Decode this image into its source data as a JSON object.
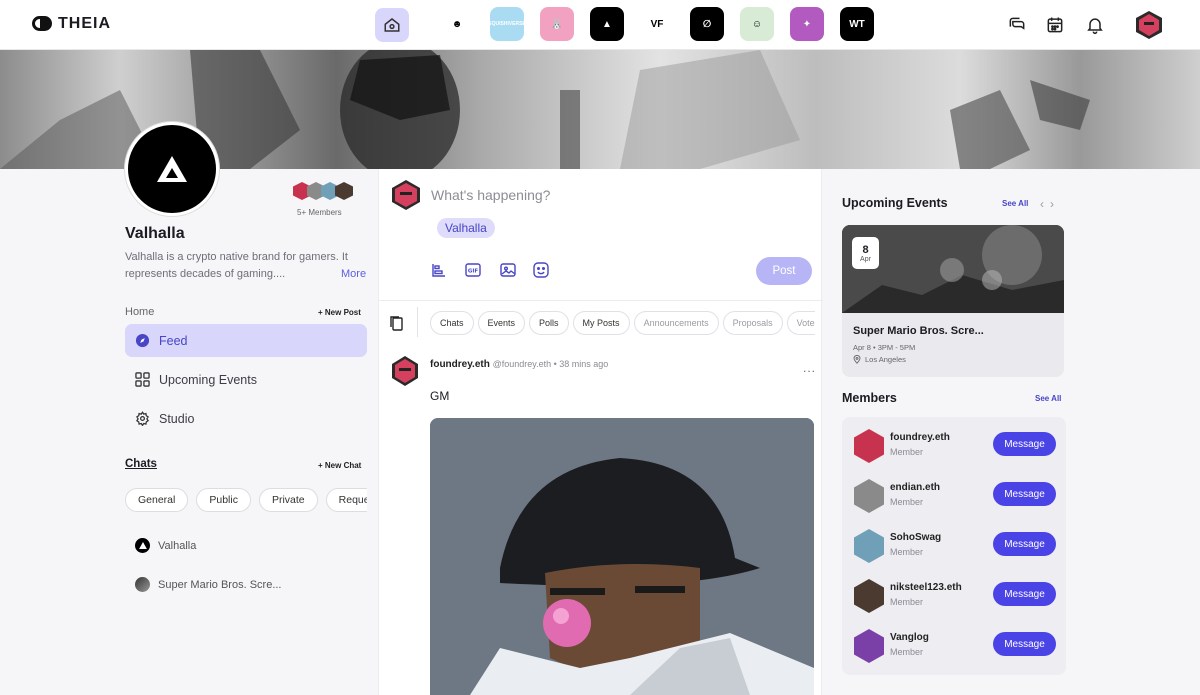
{
  "app": {
    "brand": "THEIA"
  },
  "topbar": {
    "communities": [
      {
        "name": "Drip creature",
        "color": "#ffffff",
        "fg": "#000000",
        "glyph": "☻"
      },
      {
        "name": "Squishiverse",
        "color": "#a9dcf2",
        "fg": "#ffffff",
        "glyph": "SQUISHIVERSE"
      },
      {
        "name": "Bunny",
        "color": "#f2a2c0",
        "fg": "#ffffff",
        "glyph": "🐰"
      },
      {
        "name": "Valhalla",
        "color": "#000000",
        "fg": "#ffffff",
        "glyph": "▲"
      },
      {
        "name": "VF",
        "color": "#ffffff",
        "fg": "#000000",
        "glyph": "VF"
      },
      {
        "name": "Slash",
        "color": "#000000",
        "fg": "#ffffff",
        "glyph": "∅"
      },
      {
        "name": "Character",
        "color": "#d8ecd5",
        "fg": "#000000",
        "glyph": "☺"
      },
      {
        "name": "Art",
        "color": "#b25ac0",
        "fg": "#ffffff",
        "glyph": "✦"
      },
      {
        "name": "WT",
        "color": "#000000",
        "fg": "#ffffff",
        "glyph": "WT"
      }
    ]
  },
  "community": {
    "name": "Valhalla",
    "description": "Valhalla is a crypto native brand for gamers. It represents decades of gaming....",
    "more_label": "More",
    "member_count": "5+ Members"
  },
  "left": {
    "home_label": "Home",
    "new_post_label": "+ New Post",
    "nav": [
      {
        "label": "Feed",
        "icon": "compass-icon",
        "active": true
      },
      {
        "label": "Upcoming Events",
        "icon": "grid-icon",
        "active": false
      },
      {
        "label": "Studio",
        "icon": "gear-icon",
        "active": false
      }
    ],
    "chats_label": "Chats",
    "new_chat_label": "+ New Chat",
    "chat_filters": [
      "General",
      "Public",
      "Private",
      "Requests"
    ],
    "chats": [
      {
        "label": "Valhalla"
      },
      {
        "label": "Super Mario Bros. Scre..."
      }
    ]
  },
  "composer": {
    "placeholder": "What's happening?",
    "tag": "Valhalla",
    "post_label": "Post",
    "tools": [
      "poll-icon",
      "gif-icon",
      "image-icon",
      "emoji-icon"
    ]
  },
  "feed": {
    "filters": [
      {
        "label": "Chats",
        "dim": false
      },
      {
        "label": "Events",
        "dim": false
      },
      {
        "label": "Polls",
        "dim": false
      },
      {
        "label": "My Posts",
        "dim": false
      },
      {
        "label": "Announcements",
        "dim": true
      },
      {
        "label": "Proposals",
        "dim": true
      },
      {
        "label": "Votes",
        "dim": true
      }
    ],
    "post": {
      "author": "foundrey.eth",
      "meta": "@foundrey.eth • 38 mins ago",
      "more": "...",
      "text": "GM"
    }
  },
  "events": {
    "title": "Upcoming Events",
    "see_all": "See All",
    "item": {
      "day": "8",
      "month": "Apr",
      "title": "Super Mario Bros. Scre...",
      "time": "Apr 8 • 3PM - 5PM",
      "location": "Los Angeles"
    }
  },
  "members": {
    "title": "Members",
    "see_all": "See All",
    "button_label": "Message",
    "list": [
      {
        "name": "foundrey.eth",
        "role": "Member",
        "color": "#c7334e"
      },
      {
        "name": "endian.eth",
        "role": "Member",
        "color": "#8a8a8a"
      },
      {
        "name": "SohoSwag",
        "role": "Member",
        "color": "#6fa0b8"
      },
      {
        "name": "niksteel123.eth",
        "role": "Member",
        "color": "#4a3a30"
      },
      {
        "name": "Vanglog",
        "role": "Member",
        "color": "#7b3fa8"
      }
    ]
  },
  "colors": {
    "accent": "#4a44e6",
    "accent_soft": "#d9d6fb"
  }
}
